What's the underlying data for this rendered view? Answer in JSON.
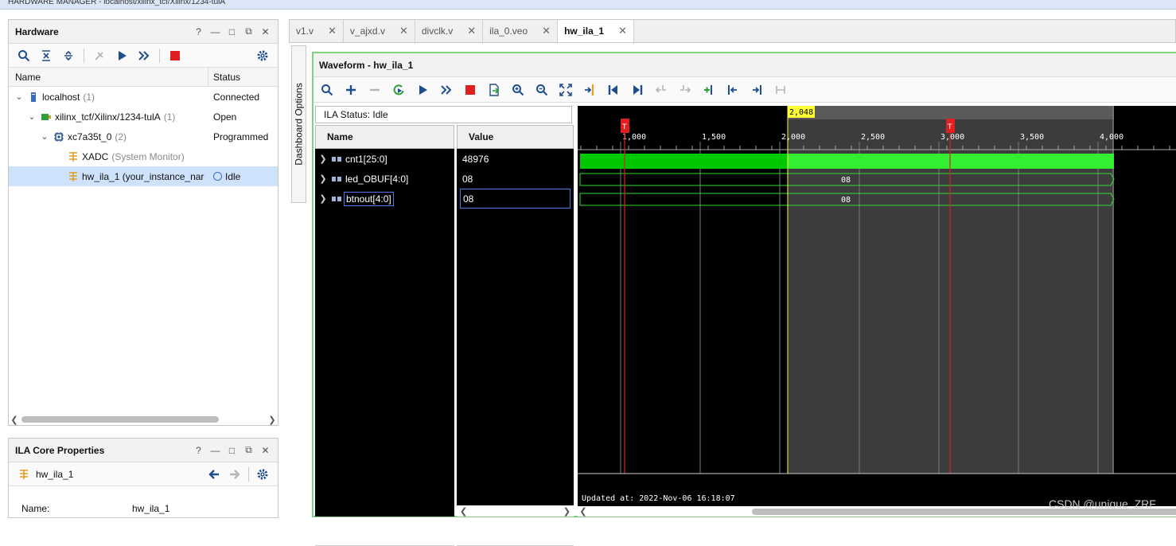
{
  "topbar": {
    "text": "HARDWARE MANAGER - localhost/xilinx_tcf/Xilinx/1234-tulA"
  },
  "hardware_panel": {
    "title": "Hardware",
    "columns": {
      "name": "Name",
      "status": "Status"
    },
    "rows": [
      {
        "name": "localhost",
        "suffix": "(1)",
        "status": "Connected"
      },
      {
        "name": "xilinx_tcf/Xilinx/1234-tulA",
        "suffix": "(1)",
        "status": "Open"
      },
      {
        "name": "xc7a35t_0",
        "suffix": "(2)",
        "status": "Programmed"
      },
      {
        "name": "XADC",
        "suffix": "(System Monitor)",
        "status": ""
      },
      {
        "name": "hw_ila_1 (your_instance_nar",
        "suffix": "",
        "status": "Idle"
      }
    ]
  },
  "ila_props": {
    "title": "ILA Core Properties",
    "item": "hw_ila_1",
    "name_label": "Name:",
    "name_value": "hw_ila_1"
  },
  "tabs": [
    {
      "label": "v1.v"
    },
    {
      "label": "v_ajxd.v"
    },
    {
      "label": "divclk.v"
    },
    {
      "label": "ila_0.veo"
    },
    {
      "label": "hw_ila_1"
    }
  ],
  "dashboard_label": "Dashboard Options",
  "waveform": {
    "title": "Waveform - hw_ila_1",
    "ila_status": "ILA Status:  Idle",
    "columns": {
      "name": "Name",
      "value": "Value"
    },
    "signals": [
      {
        "name": "cnt1[25:0]",
        "value": "48976"
      },
      {
        "name": "led_OBUF[4:0]",
        "value": "08"
      },
      {
        "name": "btnout[4:0]",
        "value": "08"
      }
    ],
    "bus_label": "08",
    "cursor_label": "2,048",
    "marker_t": "T",
    "ticks": [
      "1,000",
      "1,500",
      "2,000",
      "2,500",
      "3,000",
      "3,500",
      "4,000"
    ],
    "updated": "Updated at:  2022-Nov-06 16:18:07"
  },
  "watermark": "CSDN @unique_ZRF",
  "colors": {
    "accent_green": "#7fd27f",
    "wave_green": "#00c800",
    "bright_green": "#33ee33",
    "marker_red": "#e02020",
    "cursor_yellow": "#ffff33"
  }
}
